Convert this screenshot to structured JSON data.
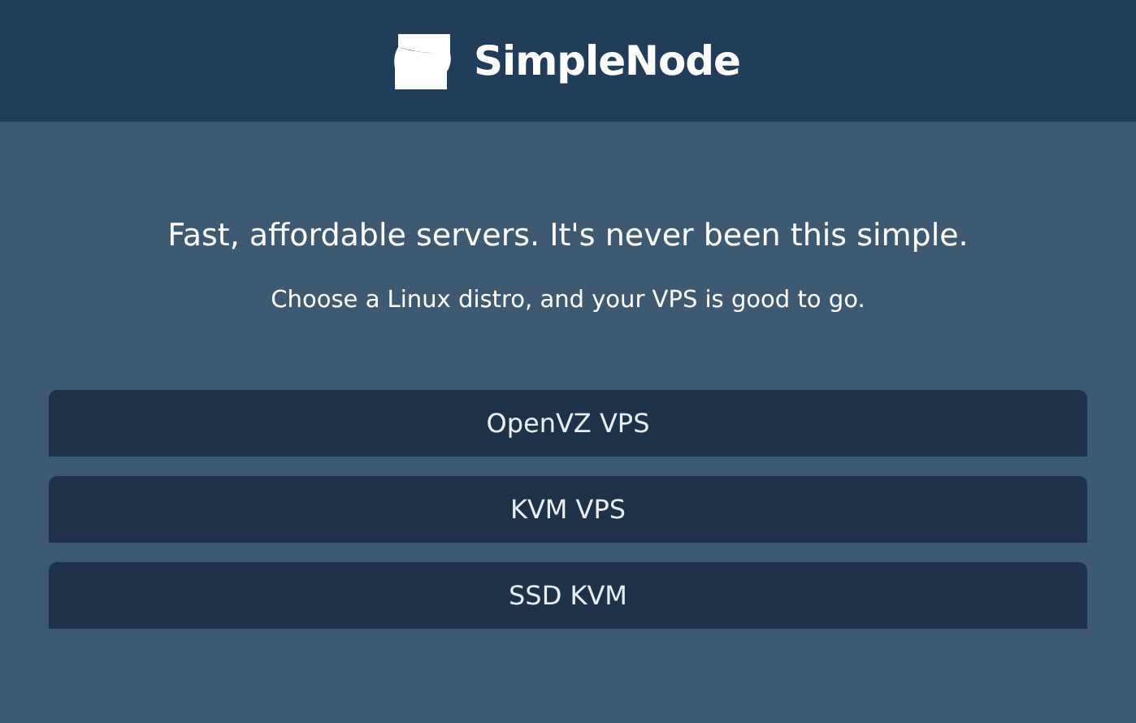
{
  "header": {
    "brand": "SimpleNode"
  },
  "hero": {
    "title": "Fast, affordable servers. It's never been this simple.",
    "subtitle": "Choose a Linux distro, and your VPS is good to go."
  },
  "plans": [
    {
      "label": "OpenVZ VPS"
    },
    {
      "label": "KVM VPS"
    },
    {
      "label": "SSD KVM"
    }
  ]
}
